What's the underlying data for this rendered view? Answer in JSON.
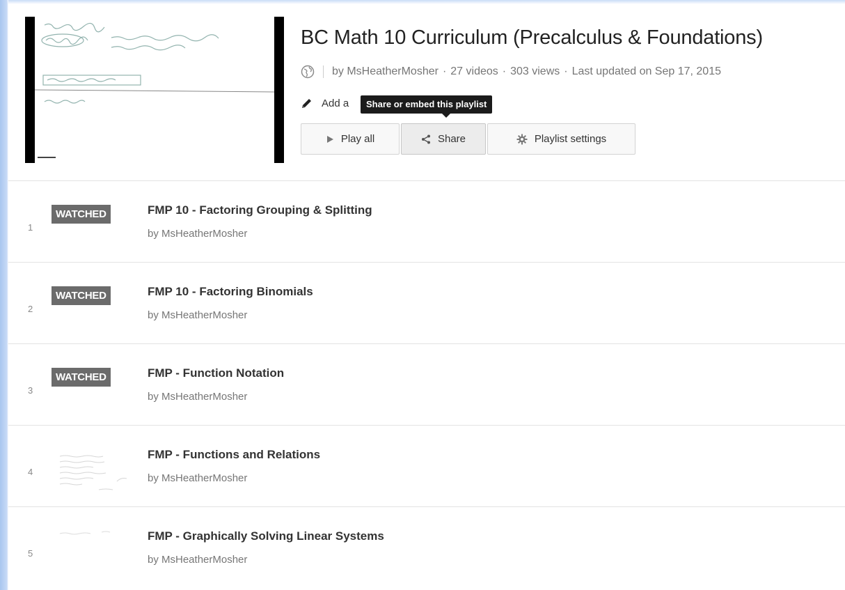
{
  "header": {
    "title": "BC Math 10 Curriculum (Precalculus & Foundations)",
    "meta": {
      "privacy_icon": "globe-icon",
      "by": "by MsHeatherMosher",
      "videos": "27 videos",
      "views": "303 views",
      "updated": "Last updated on Sep 17, 2015",
      "separator": "·"
    },
    "description_prefix": "Add a",
    "tooltip": "Share or embed this playlist",
    "buttons": {
      "play_all": "Play all",
      "share": "Share",
      "settings": "Playlist settings"
    }
  },
  "videos": [
    {
      "index": "1",
      "badge": "WATCHED",
      "title": "FMP 10 - Factoring Grouping & Splitting",
      "author": "by MsHeatherMosher"
    },
    {
      "index": "2",
      "badge": "WATCHED",
      "title": "FMP 10 - Factoring Binomials",
      "author": "by MsHeatherMosher"
    },
    {
      "index": "3",
      "badge": "WATCHED",
      "title": "FMP - Function Notation",
      "author": "by MsHeatherMosher"
    },
    {
      "index": "4",
      "badge": "",
      "title": "FMP - Functions and Relations",
      "author": "by MsHeatherMosher"
    },
    {
      "index": "5",
      "badge": "",
      "title": "FMP - Graphically Solving Linear Systems",
      "author": "by MsHeatherMosher"
    }
  ]
}
